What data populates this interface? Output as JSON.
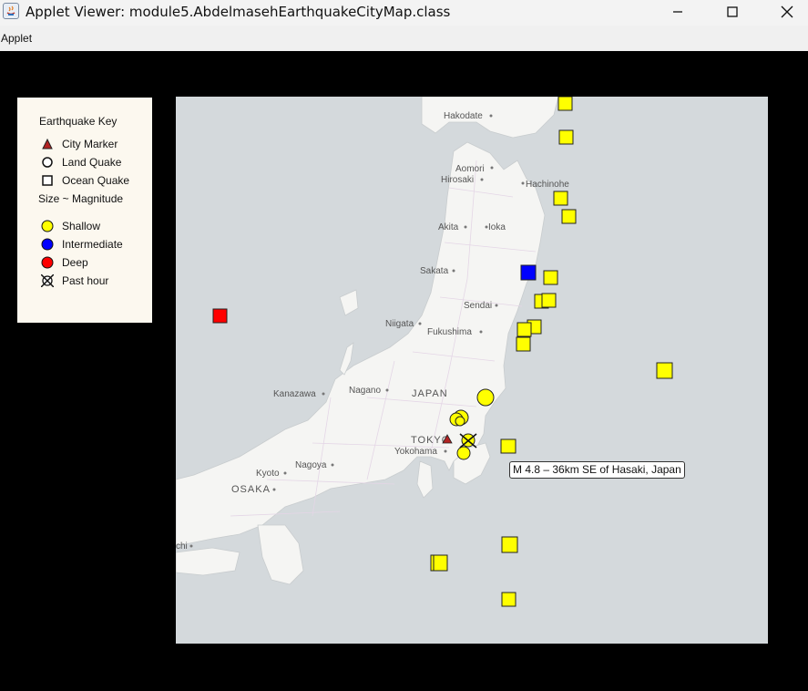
{
  "window": {
    "title": "Applet Viewer: module5.AbdelmasehEarthquakeCityMap.class",
    "minimize_icon": "minimize-icon",
    "maximize_icon": "maximize-icon",
    "close_icon": "close-icon"
  },
  "menu": {
    "items": [
      "Applet"
    ]
  },
  "key": {
    "title": "Earthquake Key",
    "items": [
      {
        "label": "City Marker",
        "icon": "triangle-icon"
      },
      {
        "label": "Land Quake",
        "icon": "circle-outline-icon"
      },
      {
        "label": "Ocean Quake",
        "icon": "square-outline-icon"
      }
    ],
    "size_label": "Size ~ Magnitude",
    "depth_items": [
      {
        "label": "Shallow",
        "color": "#ffff00"
      },
      {
        "label": "Intermediate",
        "color": "#0000ff"
      },
      {
        "label": "Deep",
        "color": "#ff0000"
      },
      {
        "label": "Past hour",
        "icon": "past-hour-icon"
      }
    ]
  },
  "map": {
    "labels": {
      "hakodate": "Hakodate",
      "aomori": "Aomori",
      "hachinohe": "Hachinohe",
      "hirosaki": "Hirosaki",
      "akita": "Akita",
      "ioka": "Ioka",
      "sakata": "Sakata",
      "sendai": "Sendai",
      "niigata": "Niigata",
      "fukushima": "Fukushima",
      "kanazawa": "Kanazawa",
      "nagano": "Nagano",
      "japan": "JAPAN",
      "tokyo": "TOKYO",
      "yokohama": "Yokohama",
      "kyoto": "Kyoto",
      "nagoya": "Nagoya",
      "osaka": "OSAKA",
      "chi": "chi"
    },
    "tooltip": "M 4.8 – 36km SE of Hasaki, Japan",
    "colors": {
      "shallow": "#ffff00",
      "intermediate": "#0000ff",
      "deep": "#ff0000",
      "city": "#b22222",
      "sea": "#d4d9dc",
      "land": "#f5f5f3"
    }
  }
}
